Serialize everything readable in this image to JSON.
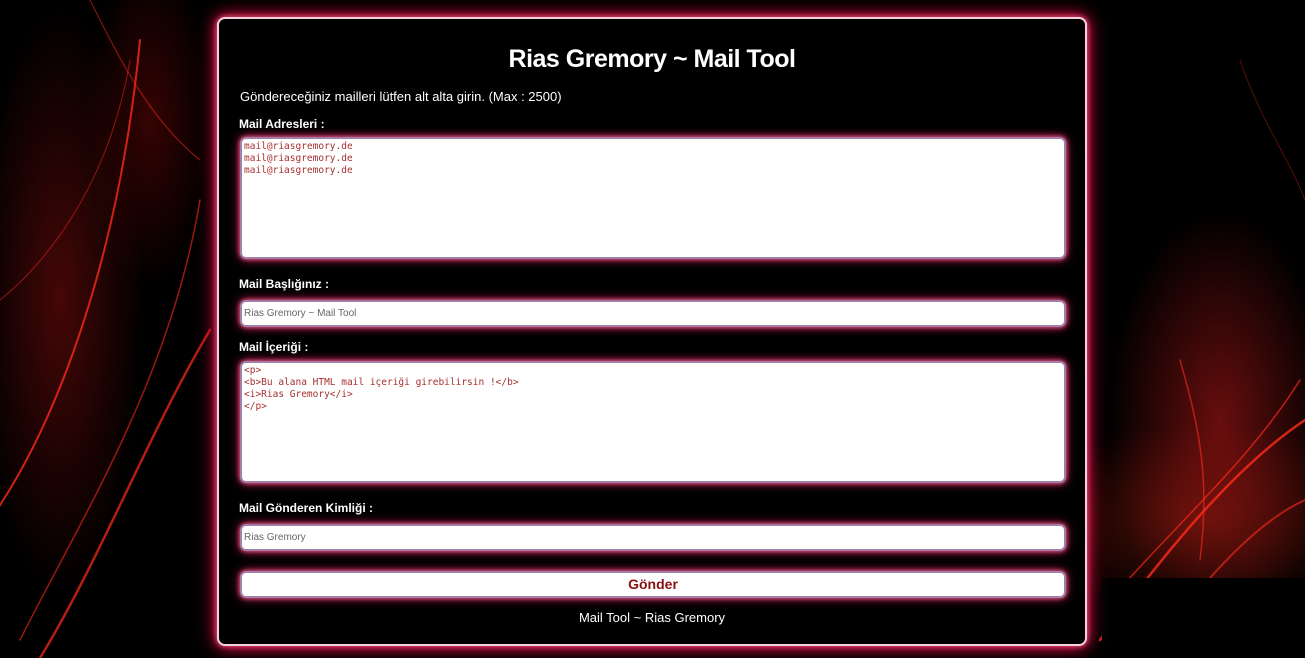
{
  "page": {
    "title": "Rias Gremory ~ Mail Tool",
    "intro": "Göndereceğiniz mailleri lütfen alt alta girin. (Max : 2500)",
    "footer": "Mail Tool ~ Rias Gremory"
  },
  "form": {
    "addresses": {
      "label": "Mail Adresleri :",
      "value": "mail@riasgremory.de\nmail@riasgremory.de\nmail@riasgremory.de"
    },
    "subject": {
      "label": "Mail Başlığınız :",
      "value": "Rias Gremory ~ Mail Tool"
    },
    "content": {
      "label": "Mail İçeriği :",
      "value": "<p>\n<b>Bu alana HTML mail içeriği girebilirsin !</b>\n<i>Rias Gremory</i>\n</p>"
    },
    "sender": {
      "label": "Mail Gönderen Kimliği :",
      "value": "Rias Gremory"
    },
    "submit_label": "Gönder"
  },
  "colors": {
    "background": "#000000",
    "glow": "#e0104a",
    "accent_text": "#8a1010"
  }
}
